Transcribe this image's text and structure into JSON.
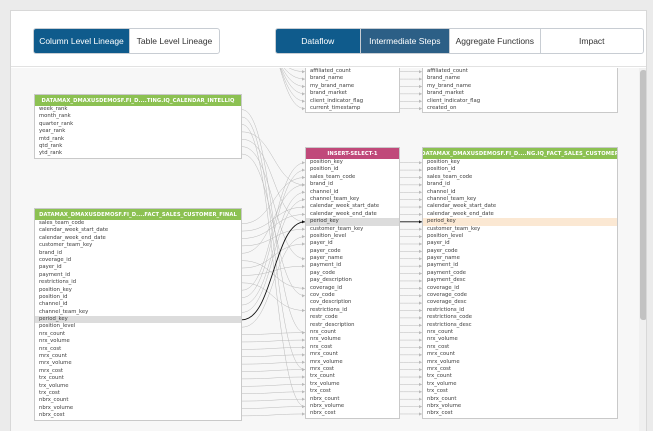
{
  "toolbar": {
    "left_tabs": [
      "Column Level Lineage",
      "Table Level Lineage"
    ],
    "right_tabs": [
      "Dataflow",
      "Intermediate Steps",
      "Aggregate Functions",
      "Impact"
    ]
  },
  "colors": {
    "primary": "#0f5b8c",
    "table_header": "#8cc152",
    "step_header": "#c0497a",
    "highlight": "#fbe8d3"
  },
  "tables": {
    "calendar": {
      "title": "DATAMAX_DMAXUSDEMOSF.FI_D....TING.IQ_CALENDAR_INTELLIQ",
      "rows": [
        "week_rank",
        "month_rank",
        "quarter_rank",
        "year_rank",
        "mtd_rank",
        "qtd_rank",
        "ytd_rank"
      ]
    },
    "sales_final": {
      "title": "DATAMAX_DMAXUSDEMOSF.FI_D....FACT_SALES_CUSTOMER_FINAL",
      "rows": [
        "sales_team_code",
        "calendar_week_start_date",
        "calendar_week_end_date",
        "customer_team_key",
        "brand_id",
        "coverage_id",
        "payer_id",
        "payment_id",
        "restrictions_id",
        "position_key",
        "position_id",
        "channel_id",
        "channel_team_key",
        "period_key",
        "position_level",
        "nrx_count",
        "nrx_volume",
        "nrx_cost",
        "mrx_count",
        "mrx_volume",
        "mrx_cost",
        "trx_count",
        "trx_volume",
        "trx_cost",
        "nbrx_count",
        "nbrx_volume",
        "nbrx_cost"
      ]
    },
    "top_mid": {
      "rows": [
        "affiliated_count",
        "brand_name",
        "my_brand_name",
        "brand_market",
        "client_indicator_flag",
        "current_timestamp"
      ]
    },
    "top_right": {
      "rows": [
        "affiliated_count",
        "brand_name",
        "my_brand_name",
        "brand_market",
        "client_indicator_flag",
        "created_on"
      ]
    },
    "insert_select": {
      "title": "INSERT-SELECT-1",
      "rows": [
        "position_key",
        "position_id",
        "sales_team_code",
        "brand_id",
        "channel_id",
        "channel_team_key",
        "calendar_week_start_date",
        "calendar_week_end_date",
        "period_key",
        "customer_team_key",
        "position_level",
        "payer_id",
        "payer_code",
        "payer_name",
        "payment_id",
        "pay_code",
        "pay_description",
        "coverage_id",
        "cov_code",
        "cov_description",
        "restrictions_id",
        "restr_code",
        "restr_description",
        "nrx_count",
        "nrx_volume",
        "nrx_cost",
        "mrx_count",
        "mrx_volume",
        "mrx_cost",
        "trx_count",
        "trx_volume",
        "trx_cost",
        "nbrx_count",
        "nbrx_volume",
        "nbrx_cost"
      ]
    },
    "fact_sales": {
      "title": "DATAMAX_DMAXUSDEMOSF.FI_D....NG.IQ_FACT_SALES_CUSTOMER",
      "rows": [
        "position_key",
        "position_id",
        "sales_team_code",
        "brand_id",
        "channel_id",
        "channel_team_key",
        "calendar_week_start_date",
        "calendar_week_end_date",
        "period_key",
        "customer_team_key",
        "position_level",
        "payer_id",
        "payer_code",
        "payer_name",
        "payment_id",
        "payment_code",
        "payment_desc",
        "coverage_id",
        "coverage_code",
        "coverage_desc",
        "restrictions_id",
        "restrictions_code",
        "restrictions_desc",
        "nrx_count",
        "nrx_volume",
        "nrx_cost",
        "mrx_count",
        "mrx_volume",
        "mrx_cost",
        "trx_count",
        "trx_volume",
        "trx_cost",
        "nbrx_count",
        "nbrx_volume",
        "nbrx_cost"
      ]
    }
  },
  "highlighted_column": "period_key"
}
